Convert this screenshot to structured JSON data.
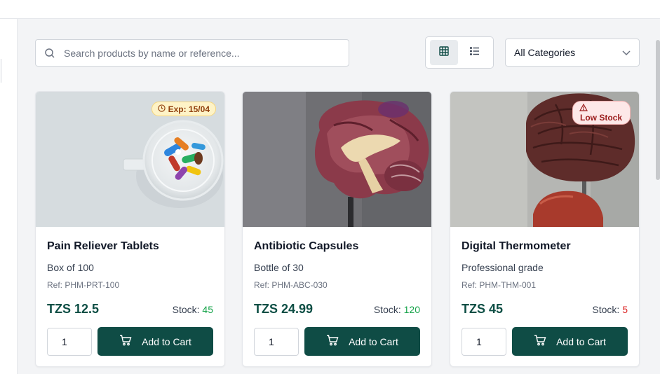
{
  "search": {
    "placeholder": "Search products by name or reference...",
    "icon": "search-icon"
  },
  "view_toggle": {
    "active": "grid",
    "icons": [
      "grid-icon",
      "list-icon"
    ]
  },
  "category_filter": {
    "selected": "All Categories",
    "icon": "chevron-down-icon"
  },
  "products": [
    {
      "name": "Pain Reliever Tablets",
      "description": "Box of 100",
      "ref": "Ref: PHM-PRT-100",
      "price": "TZS 12.5",
      "stock_label": "Stock:",
      "stock": "45",
      "stock_status": "ok",
      "badge": "Exp: 15/04",
      "badge_icon": "clock-icon",
      "image": "pills-in-glass-bowl",
      "quantity": "1",
      "add_label": "Add to Cart"
    },
    {
      "name": "Antibiotic Capsules",
      "description": "Bottle of 30",
      "ref": "Ref: PHM-ABC-030",
      "price": "TZS 24.99",
      "stock_label": "Stock:",
      "stock": "120",
      "stock_status": "ok",
      "image": "brain-anatomy-model",
      "quantity": "1",
      "add_label": "Add to Cart"
    },
    {
      "name": "Digital Thermometer",
      "description": "Professional grade",
      "ref": "Ref: PHM-THM-001",
      "price": "TZS 45",
      "stock_label": "Stock:",
      "stock": "5",
      "stock_status": "low",
      "badge": "Low Stock",
      "badge_icon": "alert-triangle-icon",
      "image": "brain-model-on-stand",
      "quantity": "1",
      "add_label": "Add to Cart"
    }
  ],
  "colors": {
    "primary": "#0f4c45",
    "price": "#0e4f45",
    "stock_ok": "#16a34a",
    "stock_low": "#dc2626",
    "background": "#f3f4f6"
  }
}
